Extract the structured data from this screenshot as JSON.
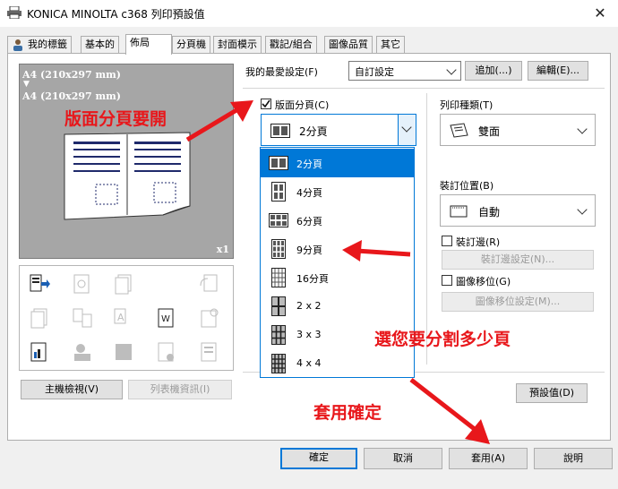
{
  "window": {
    "title": "KONICA MINOLTA c368 列印預設值",
    "close_glyph": "✕"
  },
  "tabs": [
    "我的標籤",
    "基本的",
    "佈局",
    "分頁機",
    "封面模示",
    "戳記/組合",
    "圖像品質",
    "其它"
  ],
  "preview": {
    "line1": "A4 (210x297 mm)",
    "arrow": "▼",
    "line2": "A4 (210x297 mm)",
    "zoom": "x1"
  },
  "left_buttons": {
    "printer_view": "主機檢視(V)",
    "list_info": "列表機資訊(I)"
  },
  "favorites": {
    "label": "我的最愛設定(F)",
    "value": "自訂設定",
    "add": "追加(...)",
    "edit": "編輯(E)..."
  },
  "nup": {
    "checkbox_label": "版面分頁(C)",
    "checked": true,
    "selected": "2分頁",
    "options": [
      "2分頁",
      "4分頁",
      "6分頁",
      "9分頁",
      "16分頁",
      "2 x 2",
      "3 x 3",
      "4 x 4"
    ]
  },
  "print_type": {
    "label": "列印種類(T)",
    "value": "雙面"
  },
  "binding": {
    "label": "裝訂位置(B)",
    "value": "自動"
  },
  "binding_margin": {
    "label": "裝訂邊(R)",
    "button": "裝訂邊設定(N)..."
  },
  "image_shift": {
    "label": "圖像移位(G)",
    "button": "圖像移位設定(M)..."
  },
  "defaults_button": "預設值(D)",
  "footer": {
    "ok": "確定",
    "cancel": "取消",
    "apply": "套用(A)",
    "help": "說明"
  },
  "annotations": {
    "enable_nup": "版面分頁要開",
    "choose_split": "選您要分割多少頁",
    "apply_confirm": "套用確定"
  },
  "colors": {
    "accent": "#0078d7",
    "annotation": "#e8171b",
    "preview_bg": "#a6a6a6"
  }
}
